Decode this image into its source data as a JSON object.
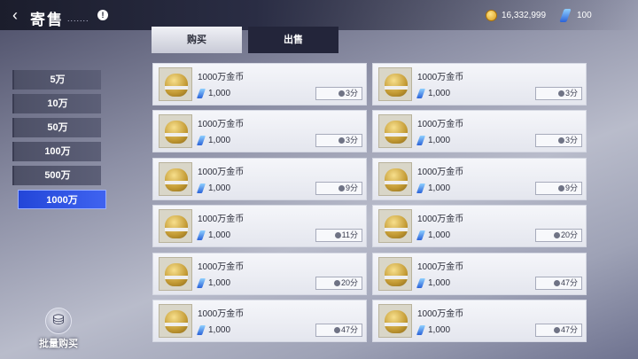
{
  "header": {
    "title": "寄售",
    "title_deco": ".......",
    "info_label": "!",
    "gold": "16,332,999",
    "gems": "100"
  },
  "tabs": [
    {
      "label": "购买",
      "active": true
    },
    {
      "label": "出售",
      "active": false
    }
  ],
  "filters": [
    {
      "label": "5万",
      "active": false
    },
    {
      "label": "10万",
      "active": false
    },
    {
      "label": "50万",
      "active": false
    },
    {
      "label": "100万",
      "active": false
    },
    {
      "label": "500万",
      "active": false
    },
    {
      "label": "1000万",
      "active": true
    }
  ],
  "bulk_buy": {
    "label": "批量购买"
  },
  "listings": [
    {
      "name": "1000万金币",
      "price": "1,000",
      "time": "3分"
    },
    {
      "name": "1000万金币",
      "price": "1,000",
      "time": "3分"
    },
    {
      "name": "1000万金币",
      "price": "1,000",
      "time": "3分"
    },
    {
      "name": "1000万金币",
      "price": "1,000",
      "time": "3分"
    },
    {
      "name": "1000万金币",
      "price": "1,000",
      "time": "9分"
    },
    {
      "name": "1000万金币",
      "price": "1,000",
      "time": "9分"
    },
    {
      "name": "1000万金币",
      "price": "1,000",
      "time": "11分"
    },
    {
      "name": "1000万金币",
      "price": "1,000",
      "time": "20分"
    },
    {
      "name": "1000万金币",
      "price": "1,000",
      "time": "20分"
    },
    {
      "name": "1000万金币",
      "price": "1,000",
      "time": "47分"
    },
    {
      "name": "1000万金币",
      "price": "1,000",
      "time": "47分"
    },
    {
      "name": "1000万金币",
      "price": "1,000",
      "time": "47分"
    }
  ],
  "colors": {
    "active_filter": "#2346d8",
    "gem": "#2a62d8",
    "gold": "#d79a1a"
  }
}
